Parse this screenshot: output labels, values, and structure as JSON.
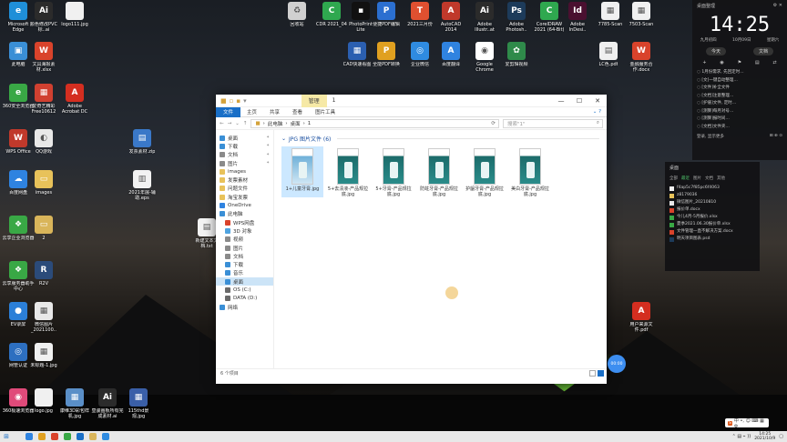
{
  "desktop_icons": [
    {
      "label": "Microsoft Edge",
      "color": "#1f8fd8",
      "glyph": "e"
    },
    {
      "label": "颜色修改PVC标..ai",
      "color": "#2b2b2b",
      "glyph": "Ai"
    },
    {
      "label": "logo111.jpg",
      "color": "#f0f0f0",
      "glyph": ""
    },
    {
      "label": "此电脑",
      "color": "#3a8fd6",
      "glyph": "▣"
    },
    {
      "label": "文具海报素材.xlsx",
      "color": "#d9432b",
      "glyph": "W"
    },
    {
      "label": "360安全浏览器",
      "color": "#39a845",
      "glyph": "e"
    },
    {
      "label": "爱奇艺精彩Free10612",
      "color": "#d04030",
      "glyph": "▦"
    },
    {
      "label": "Adobe Acrobat DC",
      "color": "#d42e20",
      "glyph": "A"
    },
    {
      "label": "WPS Office",
      "color": "#c0392b",
      "glyph": "W"
    },
    {
      "label": "QQ游戏",
      "color": "#e8e8e8",
      "glyph": "◐"
    },
    {
      "label": "发票素材.zip",
      "color": "#3a78c8",
      "glyph": "▤"
    },
    {
      "label": "百度网盘",
      "color": "#2f83e0",
      "glyph": "☁"
    },
    {
      "label": "images",
      "color": "#e8c25a",
      "glyph": "▭"
    },
    {
      "label": "2021年展-辅助.eps",
      "color": "#f2f2f2",
      "glyph": "▥"
    },
    {
      "label": "新建文本文档.txt",
      "color": "#f4f4f4",
      "glyph": "▤"
    },
    {
      "label": "云享企业浏览器",
      "color": "#39a845",
      "glyph": "❖"
    },
    {
      "label": "2",
      "color": "#d9b55a",
      "glyph": "▭"
    },
    {
      "label": "云享服务器助手中心",
      "color": "#39a845",
      "glyph": "❖"
    },
    {
      "label": "R2V",
      "color": "#2b4b7a",
      "glyph": "R"
    },
    {
      "label": "EV录屏",
      "color": "#2b7fd8",
      "glyph": "●"
    },
    {
      "label": "微信图片_2021100..",
      "color": "#e8e8e8",
      "glyph": "▦"
    },
    {
      "label": "网管认证",
      "color": "#2d6fc0",
      "glyph": "◎"
    },
    {
      "label": "未标题-1.jpg",
      "color": "#f0f0f0",
      "glyph": "▦"
    },
    {
      "label": "360极速浏览器",
      "color": "#e04a7a",
      "glyph": "◉"
    },
    {
      "label": "logo.jpg",
      "color": "#f0f0f0",
      "glyph": ""
    },
    {
      "label": "康维3D彩包样机.jpg",
      "color": "#5a8fc8",
      "glyph": "▦"
    },
    {
      "label": "皇骏画板所有完成素材.ai",
      "color": "#2b2b2b",
      "glyph": "Ai"
    },
    {
      "label": "115thd景观.jpg",
      "color": "#3a5fa8",
      "glyph": "▦"
    },
    {
      "label": "回收站",
      "color": "#d0d0d0",
      "glyph": "♻"
    },
    {
      "label": "CDR 2021_04",
      "color": "#2fa84f",
      "glyph": "C"
    },
    {
      "label": "PhotoPrint Lite",
      "color": "#111111",
      "glyph": "▪"
    },
    {
      "label": "便捷PDF编辑",
      "color": "#2b6fd0",
      "glyph": "P"
    },
    {
      "label": "2021三月份",
      "color": "#e05030",
      "glyph": "T"
    },
    {
      "label": "AutoCAD 2014",
      "color": "#c0392b",
      "glyph": "A"
    },
    {
      "label": "Adobe Illustr..at",
      "color": "#2b2b2b",
      "glyph": "Ai"
    },
    {
      "label": "Adobe Photosh..",
      "color": "#1d3b5a",
      "glyph": "Ps"
    },
    {
      "label": "CorelDRAW 2021 (64-Bit)",
      "color": "#2fa84f",
      "glyph": "C"
    },
    {
      "label": "Adobe InDesi..",
      "color": "#4a1030",
      "glyph": "Id"
    },
    {
      "label": "7785-Scan",
      "color": "#f0f0f0",
      "glyph": "▦"
    },
    {
      "label": "7503-Scan",
      "color": "#f0f0f0",
      "glyph": "▦"
    },
    {
      "label": "CAD快速看图",
      "color": "#2b5fb0",
      "glyph": "▦"
    },
    {
      "label": "全能PDF转换",
      "color": "#e0a020",
      "glyph": "P"
    },
    {
      "label": "企业微信",
      "color": "#2f8be0",
      "glyph": "◎"
    },
    {
      "label": "百度翻译",
      "color": "#2f83e0",
      "glyph": "A"
    },
    {
      "label": "Google Chrome",
      "color": "#ffffff",
      "glyph": "◉"
    },
    {
      "label": "爱剪辑视频",
      "color": "#2f8a4a",
      "glyph": "✿"
    },
    {
      "label": "LC色.pdf",
      "color": "#f0f0f0",
      "glyph": "▤"
    },
    {
      "label": "金融服务合作.docx",
      "color": "#d9432b",
      "glyph": "W"
    },
    {
      "label": "用户来源文件.pdf",
      "color": "#d42e20",
      "glyph": "A"
    }
  ],
  "window": {
    "title": "1",
    "manage_tab": "管理",
    "ribbon_file": "文件",
    "ribbon_tabs": [
      "主页",
      "共享",
      "查看",
      "图片工具"
    ],
    "help_icon": "help-icon",
    "path_segments": [
      "此电脑",
      "桌面",
      "1"
    ],
    "search_placeholder": "搜索\"1\"",
    "group_title": "JPG 图片文件 (6)",
    "status": "6 个项目"
  },
  "sidebar": [
    {
      "label": "桌面",
      "color": "#3a8fd6",
      "pinned": true,
      "indent": false,
      "selected": false
    },
    {
      "label": "下载",
      "color": "#3a8fd6",
      "pinned": true,
      "indent": false,
      "selected": false
    },
    {
      "label": "文档",
      "color": "#8a8a8a",
      "pinned": true,
      "indent": false,
      "selected": false
    },
    {
      "label": "图片",
      "color": "#8a8a8a",
      "pinned": true,
      "indent": false,
      "selected": false
    },
    {
      "label": "images",
      "color": "#e8c25a",
      "pinned": false,
      "indent": false,
      "selected": false
    },
    {
      "label": "发票素材",
      "color": "#e8c25a",
      "pinned": false,
      "indent": false,
      "selected": false
    },
    {
      "label": "问题文件",
      "color": "#e8c25a",
      "pinned": false,
      "indent": false,
      "selected": false
    },
    {
      "label": "淘宝发票",
      "color": "#e8c25a",
      "pinned": false,
      "indent": false,
      "selected": false
    },
    {
      "label": "OneDrive",
      "color": "#2f83e0",
      "pinned": false,
      "indent": false,
      "selected": false
    },
    {
      "label": "此电脑",
      "color": "#3a8fd6",
      "pinned": false,
      "indent": false,
      "selected": false
    },
    {
      "label": "WPS网盘",
      "color": "#d9432b",
      "pinned": false,
      "indent": true,
      "selected": false
    },
    {
      "label": "3D 对象",
      "color": "#4fa3e0",
      "pinned": false,
      "indent": true,
      "selected": false
    },
    {
      "label": "视频",
      "color": "#8a8a8a",
      "pinned": false,
      "indent": true,
      "selected": false
    },
    {
      "label": "图片",
      "color": "#8a8a8a",
      "pinned": false,
      "indent": true,
      "selected": false
    },
    {
      "label": "文档",
      "color": "#8a8a8a",
      "pinned": false,
      "indent": true,
      "selected": false
    },
    {
      "label": "下载",
      "color": "#3a8fd6",
      "pinned": false,
      "indent": true,
      "selected": false
    },
    {
      "label": "音乐",
      "color": "#3a8fd6",
      "pinned": false,
      "indent": true,
      "selected": false
    },
    {
      "label": "桌面",
      "color": "#3a8fd6",
      "pinned": false,
      "indent": true,
      "selected": true
    },
    {
      "label": "OS (C:)",
      "color": "#6a6a6a",
      "pinned": false,
      "indent": true,
      "selected": false
    },
    {
      "label": "DATA (D:)",
      "color": "#6a6a6a",
      "pinned": false,
      "indent": true,
      "selected": false
    },
    {
      "label": "网络",
      "color": "#3a8fd6",
      "pinned": false,
      "indent": false,
      "selected": false
    }
  ],
  "files": [
    {
      "name": "1+儿童牙膏.jpg",
      "selected": true
    },
    {
      "name": "5+去渍液-产品规拉底.jpg",
      "selected": false
    },
    {
      "name": "5+牙膏-产品规拉底.jpg",
      "selected": false
    },
    {
      "name": "防蛀牙膏-产品规拉底.jpg",
      "selected": false
    },
    {
      "name": "护龈牙膏-产品规拉底.jpg",
      "selected": false
    },
    {
      "name": "美白牙膏-产品规拉底.jpg",
      "selected": false
    }
  ],
  "bubble": "00:00",
  "panel_top": {
    "header_left": "桌面整理",
    "header_right": "⚙ ✕",
    "time": "14:25",
    "date": [
      "九月初四",
      "10月09日",
      "星期六"
    ],
    "buttons": [
      "今天",
      "文档"
    ],
    "chips": [
      "+",
      "◉",
      "⚑",
      "▤",
      "⇄"
    ],
    "tasks": [
      "1月份需求, 先回定时…",
      "[文]一键自动整理…",
      "[文件]补全文件",
      "[文档]注意整理…",
      "[护盾]文件, 定时…",
      "[测算]每月对号…",
      "[测算]报时间…",
      "[文档]文件夹…"
    ],
    "footer_left": "登录, 显示更多",
    "footer_right": "⊞ ⊕ ⊙"
  },
  "panel_bot": {
    "header": "桌面",
    "tabs": [
      "全部",
      "最近",
      "图片",
      "文档",
      "其他"
    ],
    "active_tab": "最近",
    "files": [
      {
        "name": "f4ap5c7f85pc6f4063",
        "color": "#f0f0f0"
      },
      {
        "name": "z8179036",
        "color": "#e8c25a"
      },
      {
        "name": "微信图片_20210810",
        "color": "#e8e8e8"
      },
      {
        "name": "报价单.docx",
        "color": "#d9432b"
      },
      {
        "name": "今儿4月-5月报价.xlsx",
        "color": "#39a845"
      },
      {
        "name": "夏季2021.06.30报价单.xlsx",
        "color": "#39a845"
      },
      {
        "name": "文件管理一直不解决方案.docx",
        "color": "#d9432b"
      },
      {
        "name": "明天项目图表.psd",
        "color": "#1d3b5a"
      }
    ]
  },
  "taskbar": {
    "start_icon": "windows-icon",
    "apps": [
      "#2f83e0",
      "#e0a020",
      "#d9432b",
      "#39a845",
      "#1a6fc7",
      "#d9b55a",
      "#2f8be0"
    ],
    "tray": "⌃ ▤ ⌁ ))",
    "time": "14:25",
    "date": "2021/10/9"
  },
  "ime": {
    "logo": "S",
    "text": "中 •, ☺ ⌨ ▦ ⚙"
  }
}
